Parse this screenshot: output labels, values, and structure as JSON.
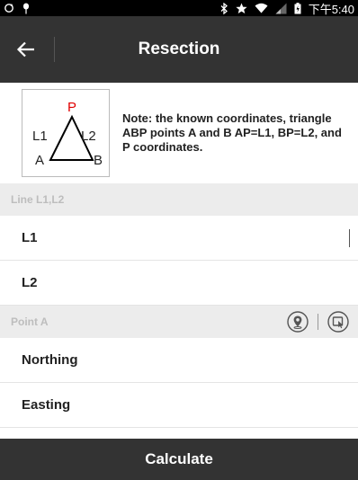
{
  "status_bar": {
    "left_icons": [
      "sync-icon",
      "debug-icon"
    ],
    "right_icons": [
      "bluetooth-icon",
      "star-icon",
      "wifi-icon",
      "signal-icon",
      "battery-icon"
    ],
    "time": "下午5:40"
  },
  "header": {
    "title": "Resection",
    "back_icon": "arrow-left-icon"
  },
  "diagram": {
    "label_p": "P",
    "label_l1": "L1",
    "label_l2": "L2",
    "label_a": "A",
    "label_b": "B",
    "p_color": "#e00000"
  },
  "note": "Note: the known coordinates, triangle ABP points A and B AP=L1, BP=L2, and P coordinates.",
  "sections": {
    "line": {
      "header": "Line L1,L2",
      "rows": [
        {
          "label": "L1",
          "value": ""
        },
        {
          "label": "L2",
          "value": ""
        }
      ]
    },
    "point_a": {
      "header": "Point A",
      "icons": [
        "location-pin-icon",
        "select-point-icon"
      ],
      "rows": [
        {
          "label": "Northing",
          "value": ""
        },
        {
          "label": "Easting",
          "value": ""
        }
      ]
    }
  },
  "calculate_label": "Calculate",
  "colors": {
    "bar_bg": "#333333",
    "section_bg": "#ececec",
    "section_text": "#bdbdbd"
  }
}
